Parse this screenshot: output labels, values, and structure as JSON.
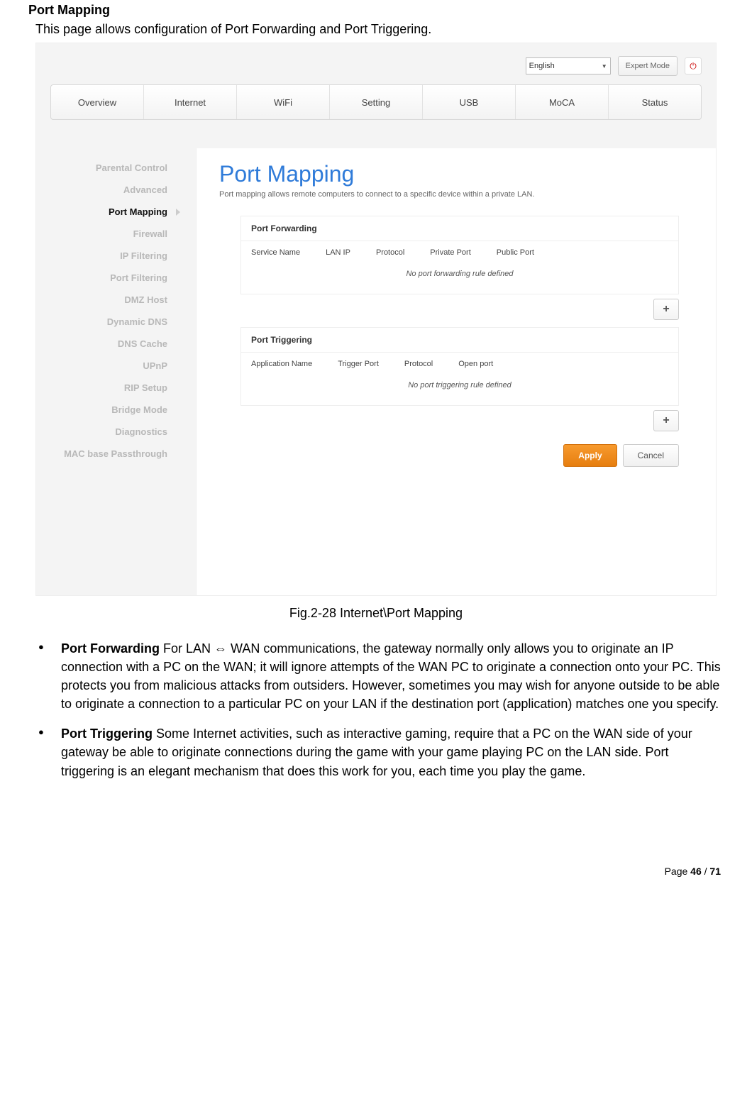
{
  "doc": {
    "heading": "Port Mapping",
    "intro": "This page allows configuration of Port Forwarding and Port Triggering.",
    "fig_caption": "Fig.2-28 Internet\\Port Mapping",
    "page_label_prefix": "Page ",
    "page_current": "46",
    "page_sep": " / ",
    "page_total": "71"
  },
  "ui": {
    "language": "English",
    "expert_mode": "Expert Mode",
    "tabs": [
      "Overview",
      "Internet",
      "WiFi",
      "Setting",
      "USB",
      "MoCA",
      "Status"
    ],
    "sidebar": [
      "Parental Control",
      "Advanced",
      "Port Mapping",
      "Firewall",
      "IP Filtering",
      "Port Filtering",
      "DMZ Host",
      "Dynamic DNS",
      "DNS Cache",
      "UPnP",
      "RIP Setup",
      "Bridge Mode",
      "Diagnostics",
      "MAC base Passthrough"
    ],
    "sidebar_active_index": 2,
    "title": "Port Mapping",
    "subtitle": "Port mapping allows remote computers to connect to a specific device within a private LAN.",
    "port_forwarding": {
      "header": "Port Forwarding",
      "cols": [
        "Service Name",
        "LAN IP",
        "Protocol",
        "Private Port",
        "Public Port"
      ],
      "empty": "No port forwarding rule defined"
    },
    "port_triggering": {
      "header": "Port Triggering",
      "cols": [
        "Application Name",
        "Trigger Port",
        "Protocol",
        "Open port"
      ],
      "empty": "No port triggering rule defined"
    },
    "apply": "Apply",
    "cancel": "Cancel",
    "plus": "+"
  },
  "bullets": {
    "pf_title": "Port Forwarding",
    "pf_body": " For LAN ⇔ WAN communications, the gateway normally only allows you to originate an IP connection with a PC on the WAN; it will ignore attempts of the WAN PC to originate a connection onto your PC. This protects you from malicious attacks from outsiders. However, sometimes you may wish for anyone outside to be able to originate a connection to a particular PC on your LAN if the destination port (application) matches one you specify.",
    "pt_title": "Port Triggering",
    "pt_body": " Some Internet activities, such as interactive gaming, require that a PC on the WAN side of your gateway be able to originate connections during the game with your game playing PC on the LAN side. Port triggering is an elegant mechanism that does this work for you, each time you play the game."
  }
}
